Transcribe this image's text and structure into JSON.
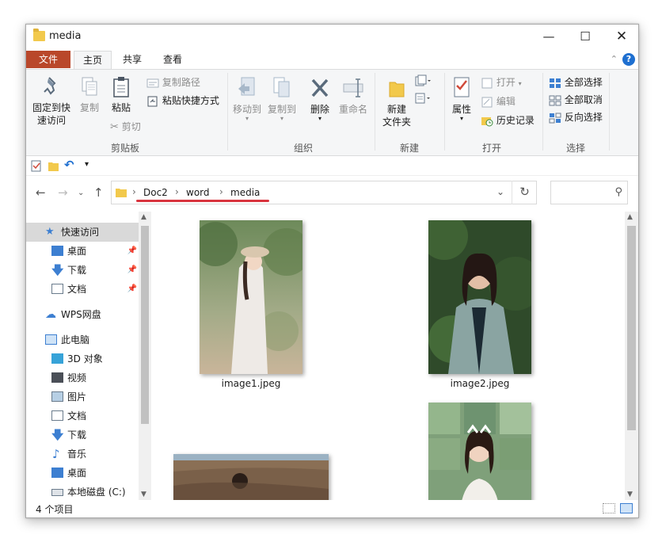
{
  "window": {
    "title": "media"
  },
  "tabs": {
    "file": "文件",
    "home": "主页",
    "share": "共享",
    "view": "查看"
  },
  "ribbon": {
    "clipboard": {
      "pin_label_1": "固定到快",
      "pin_label_2": "速访问",
      "copy": "复制",
      "paste": "粘贴",
      "copy_path": "复制路径",
      "paste_shortcut": "粘贴快捷方式",
      "cut": "剪切",
      "group": "剪贴板"
    },
    "organize": {
      "move_to": "移动到",
      "copy_to": "复制到",
      "delete": "删除",
      "rename": "重命名",
      "group": "组织"
    },
    "new": {
      "new_folder_1": "新建",
      "new_folder_2": "文件夹",
      "group": "新建"
    },
    "open": {
      "properties": "属性",
      "open": "打开",
      "edit": "编辑",
      "history": "历史记录",
      "group": "打开"
    },
    "select": {
      "select_all": "全部选择",
      "select_none": "全部取消",
      "invert": "反向选择",
      "group": "选择"
    }
  },
  "address": {
    "crumbs": [
      "Doc2",
      "word",
      "media"
    ],
    "separator": "›"
  },
  "nav_pane": {
    "quick_access": "快速访问",
    "qa_items": [
      "桌面",
      "下载",
      "文档"
    ],
    "wps": "WPS网盘",
    "this_pc": "此电脑",
    "pc_items": [
      "3D 对象",
      "视频",
      "图片",
      "文档",
      "下载",
      "音乐",
      "桌面",
      "本地磁盘 (C:)"
    ]
  },
  "files": [
    {
      "name": "image1.jpeg"
    },
    {
      "name": "image2.jpeg"
    },
    {
      "name": ""
    },
    {
      "name": ""
    }
  ],
  "status": {
    "count": "4 个项目"
  },
  "colors": {
    "file_tab": "#b9472a",
    "accent": "#1e6fd0",
    "underline": "#d9343e",
    "folder": "#f2c94c"
  }
}
